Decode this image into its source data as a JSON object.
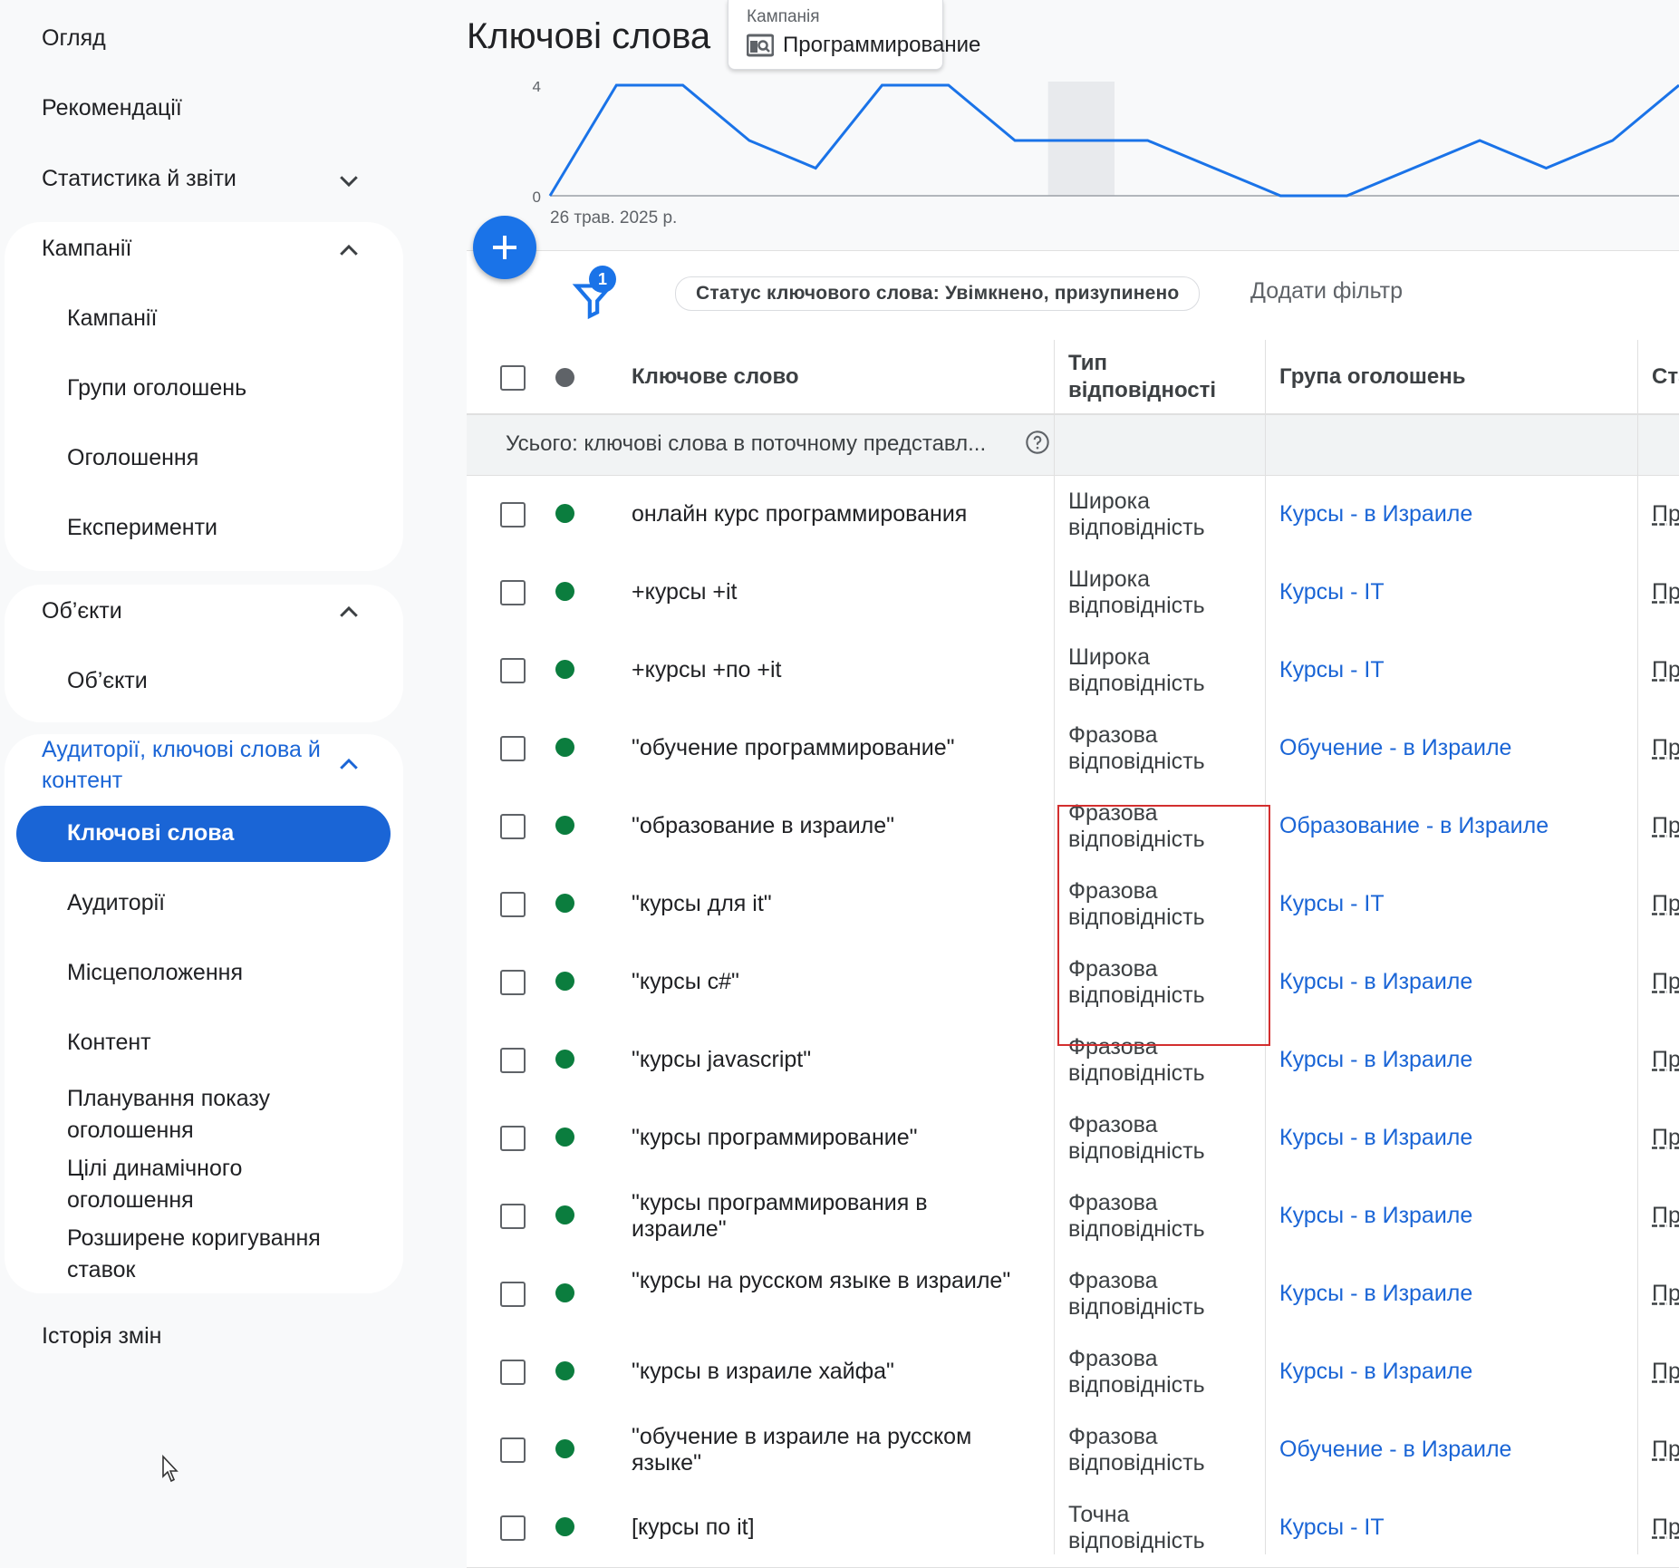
{
  "sidebar": {
    "overview": "Огляд",
    "recommendations": "Рекомендації",
    "stats": "Статистика й звіти",
    "campaigns_group": "Кампанії",
    "campaigns_items": [
      "Кампанії",
      "Групи оголошень",
      "Оголошення",
      "Експерименти"
    ],
    "assets_group": "Об’єкти",
    "assets_items": [
      "Об’єкти"
    ],
    "audiences_group": "Аудиторії, ключові слова й контент",
    "audiences_items": [
      "Ключові слова",
      "Аудиторії",
      "Місцеположення",
      "Контент",
      "Планування показу оголошення",
      "Цілі динамічного оголошення",
      "Розширене коригування ставок"
    ],
    "change_history": "Історія змін"
  },
  "header": {
    "title": "Ключові слова",
    "campaign_label": "Кампанія",
    "campaign_name": "Программирование"
  },
  "chart": {
    "y_ticks": [
      "4",
      "0"
    ],
    "x_label": "26 трав. 2025 р."
  },
  "chart_data": {
    "type": "line",
    "x_start": "26 трав. 2025 р.",
    "series": [
      {
        "values": [
          0,
          4,
          4,
          2,
          1,
          4,
          4,
          2,
          2,
          2,
          1,
          0,
          0,
          1,
          2,
          1,
          2,
          4
        ]
      }
    ],
    "y_ticks": [
      0,
      4
    ],
    "highlight_index": 8,
    "color": "#1a73e8"
  },
  "filters": {
    "badge_count": "1",
    "chip": "Статус ключового слова: Увімкнено, призупинено",
    "add_filter": "Додати фільтр"
  },
  "table": {
    "headers": {
      "keyword": "Ключове слово",
      "match_type": "Тип відповідності",
      "ad_group": "Група оголошень",
      "status": "Ста"
    },
    "total_label": "Усього: ключові слова в поточному представл...",
    "rows": [
      {
        "keyword": "онлайн курс программирования",
        "match": "Широка відповідність",
        "group": "Курсы - в Израиле",
        "status": "Пр"
      },
      {
        "keyword": "+курсы +it",
        "match": "Широка відповідність",
        "group": "Курсы - IT",
        "status": "Пр"
      },
      {
        "keyword": "+курсы +по +it",
        "match": "Широка відповідність",
        "group": "Курсы - IT",
        "status": "Пр"
      },
      {
        "keyword": "\"обучение программирование\"",
        "match": "Фразова відповідність",
        "group": "Обучение - в Израиле",
        "status": "Пр"
      },
      {
        "keyword": "\"образование в израиле\"",
        "match": "Фразова відповідність",
        "group": "Образование - в Израиле",
        "status": "Пр"
      },
      {
        "keyword": "\"курсы для it\"",
        "match": "Фразова відповідність",
        "group": "Курсы - IT",
        "status": "Пр"
      },
      {
        "keyword": "\"курсы с#\"",
        "match": "Фразова відповідність",
        "group": "Курсы - в Израиле",
        "status": "Пр"
      },
      {
        "keyword": "\"курсы javascript\"",
        "match": "Фразова відповідність",
        "group": "Курсы - в Израиле",
        "status": "Пр"
      },
      {
        "keyword": "\"курсы программирование\"",
        "match": "Фразова відповідність",
        "group": "Курсы - в Израиле",
        "status": "Пр"
      },
      {
        "keyword": "\"курсы программирования в израиле\"",
        "match": "Фразова відповідність",
        "group": "Курсы - в Израиле",
        "status": "Пр"
      },
      {
        "keyword": "\"курсы на русском языке в израиле\"",
        "match": "Фразова відповідність",
        "group": "Курсы - в Израиле",
        "status": "Пр"
      },
      {
        "keyword": "\"курсы в израиле хайфа\"",
        "match": "Фразова відповідність",
        "group": "Курсы - в Израиле",
        "status": "Пр"
      },
      {
        "keyword": "\"обучение в израиле на русском языке\"",
        "match": "Фразова відповідність",
        "group": "Обучение - в Израиле",
        "status": "Пр"
      },
      {
        "keyword": "[курсы по it]",
        "match": "Точна відповідність",
        "group": "Курсы - IT",
        "status": "Пр"
      }
    ]
  },
  "colors": {
    "accent": "#1a65d6",
    "status_enabled": "#0b7d3e",
    "highlight": "#d32f2f"
  }
}
